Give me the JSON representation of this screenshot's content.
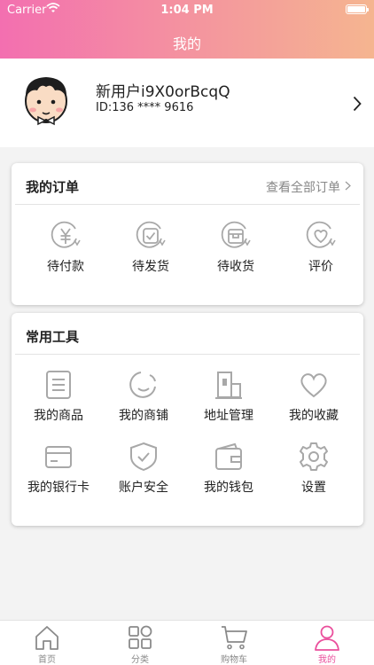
{
  "status_bar": {
    "carrier": "Carrier",
    "time": "1:04 PM"
  },
  "header": {
    "title": "我的"
  },
  "profile": {
    "username": "新用户i9X0orBcqQ",
    "user_id": "ID:136 **** 9616"
  },
  "orders": {
    "title": "我的订单",
    "view_all": "查看全部订单",
    "items": [
      {
        "label": "待付款",
        "icon": "yuan-icon"
      },
      {
        "label": "待发货",
        "icon": "ship-box-icon"
      },
      {
        "label": "待收货",
        "icon": "receive-box-icon"
      },
      {
        "label": "评价",
        "icon": "heart-review-icon"
      }
    ]
  },
  "tools": {
    "title": "常用工具",
    "items": [
      {
        "label": "我的商品",
        "icon": "document-icon"
      },
      {
        "label": "我的商铺",
        "icon": "smile-icon"
      },
      {
        "label": "地址管理",
        "icon": "building-icon"
      },
      {
        "label": "我的收藏",
        "icon": "heart-icon"
      },
      {
        "label": "我的银行卡",
        "icon": "bank-card-icon"
      },
      {
        "label": "账户安全",
        "icon": "shield-icon"
      },
      {
        "label": "我的钱包",
        "icon": "wallet-icon"
      },
      {
        "label": "设置",
        "icon": "gear-icon"
      }
    ]
  },
  "tabbar": {
    "items": [
      {
        "label": "首页",
        "icon": "home-icon"
      },
      {
        "label": "分类",
        "icon": "grid-icon"
      },
      {
        "label": "购物车",
        "icon": "cart-icon"
      },
      {
        "label": "我的",
        "icon": "user-icon",
        "active": true
      }
    ]
  },
  "colors": {
    "accent": "#ea4f9c",
    "header_start": "#f36fb0",
    "header_end": "#f5b590",
    "icon_gray": "#a8a8a8"
  }
}
